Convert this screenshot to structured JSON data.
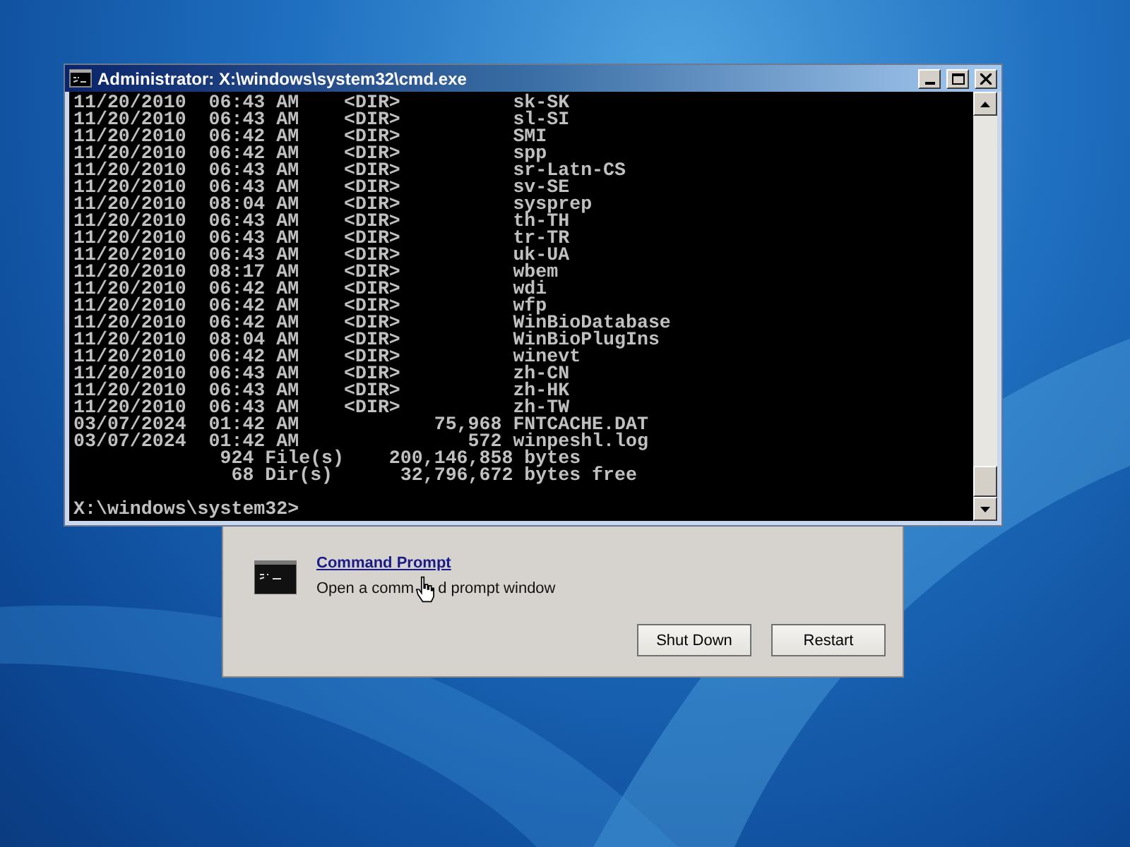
{
  "console_window": {
    "title": "Administrator: X:\\windows\\system32\\cmd.exe",
    "lines": [
      "11/20/2010  06:43 AM    <DIR>          sk-SK",
      "11/20/2010  06:43 AM    <DIR>          sl-SI",
      "11/20/2010  06:42 AM    <DIR>          SMI",
      "11/20/2010  06:42 AM    <DIR>          spp",
      "11/20/2010  06:43 AM    <DIR>          sr-Latn-CS",
      "11/20/2010  06:43 AM    <DIR>          sv-SE",
      "11/20/2010  08:04 AM    <DIR>          sysprep",
      "11/20/2010  06:43 AM    <DIR>          th-TH",
      "11/20/2010  06:43 AM    <DIR>          tr-TR",
      "11/20/2010  06:43 AM    <DIR>          uk-UA",
      "11/20/2010  08:17 AM    <DIR>          wbem",
      "11/20/2010  06:42 AM    <DIR>          wdi",
      "11/20/2010  06:42 AM    <DIR>          wfp",
      "11/20/2010  06:42 AM    <DIR>          WinBioDatabase",
      "11/20/2010  08:04 AM    <DIR>          WinBioPlugIns",
      "11/20/2010  06:42 AM    <DIR>          winevt",
      "11/20/2010  06:43 AM    <DIR>          zh-CN",
      "11/20/2010  06:43 AM    <DIR>          zh-HK",
      "11/20/2010  06:43 AM    <DIR>          zh-TW",
      "03/07/2024  01:42 AM            75,968 FNTCACHE.DAT",
      "03/07/2024  01:42 AM               572 winpeshl.log",
      "             924 File(s)    200,146,858 bytes",
      "              68 Dir(s)      32,796,672 bytes free"
    ],
    "prompt": "X:\\windows\\system32>"
  },
  "recovery_window": {
    "tool": {
      "title": "Command Prompt",
      "description": [
        "Open a comm",
        "d prompt window"
      ]
    },
    "buttons": [
      "Shut Down",
      "Restart"
    ]
  }
}
